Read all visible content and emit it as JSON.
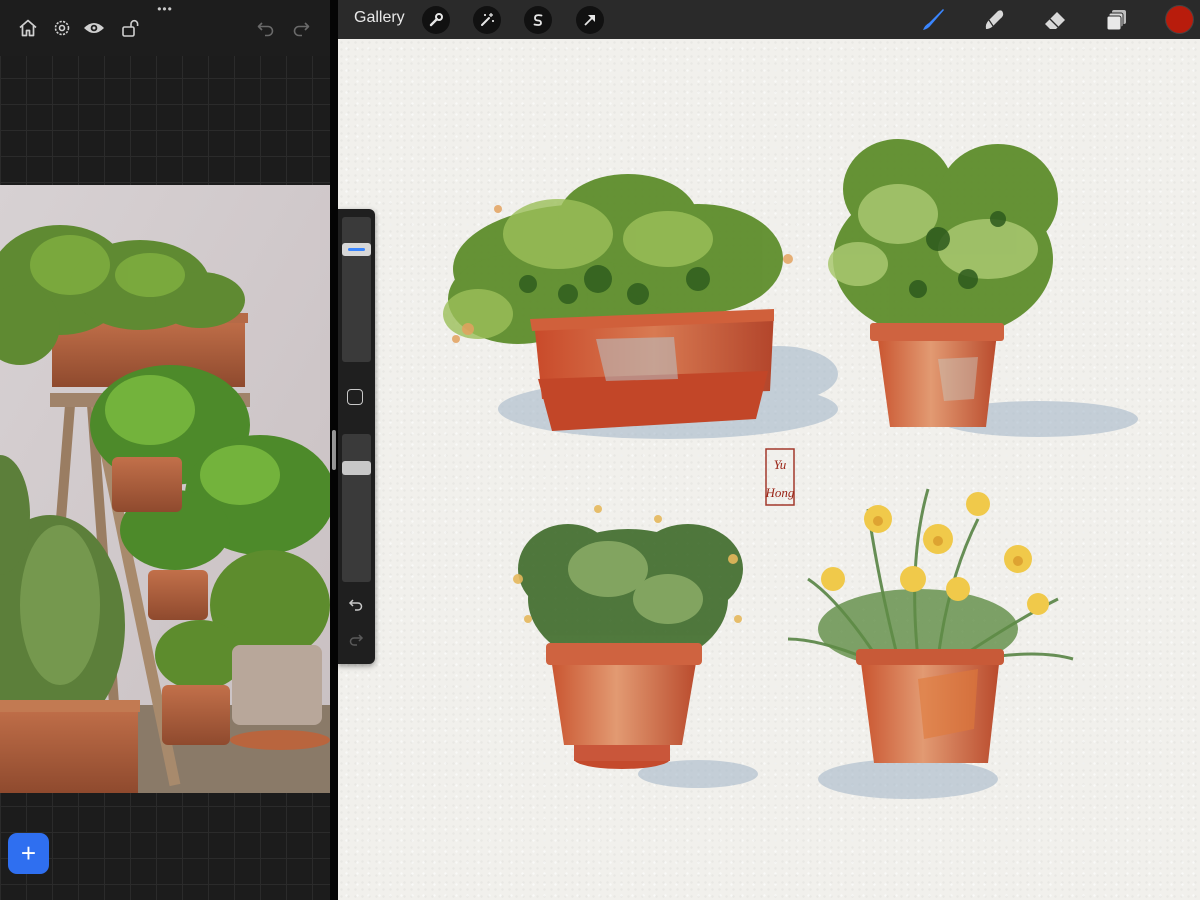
{
  "left_toolbar": {
    "icons": [
      "home-icon",
      "settings-icon",
      "eye-icon",
      "lock-open-icon",
      "undo-icon",
      "redo-icon"
    ],
    "more": "•••"
  },
  "add_button": {
    "label": "+"
  },
  "topbar": {
    "gallery_label": "Gallery",
    "tools": [
      "wrench-icon",
      "magic-wand-icon",
      "selection-icon",
      "transform-arrow-icon"
    ],
    "right_tools": [
      "brush-icon",
      "smudge-icon",
      "eraser-icon",
      "layers-icon"
    ],
    "active_tool": "brush",
    "active_color": "#b81c0c"
  },
  "sidebar": {
    "brush_size_level": 0.8,
    "opacity_level": 0.8
  },
  "canvas": {
    "signature_text": "Yu Hong"
  }
}
